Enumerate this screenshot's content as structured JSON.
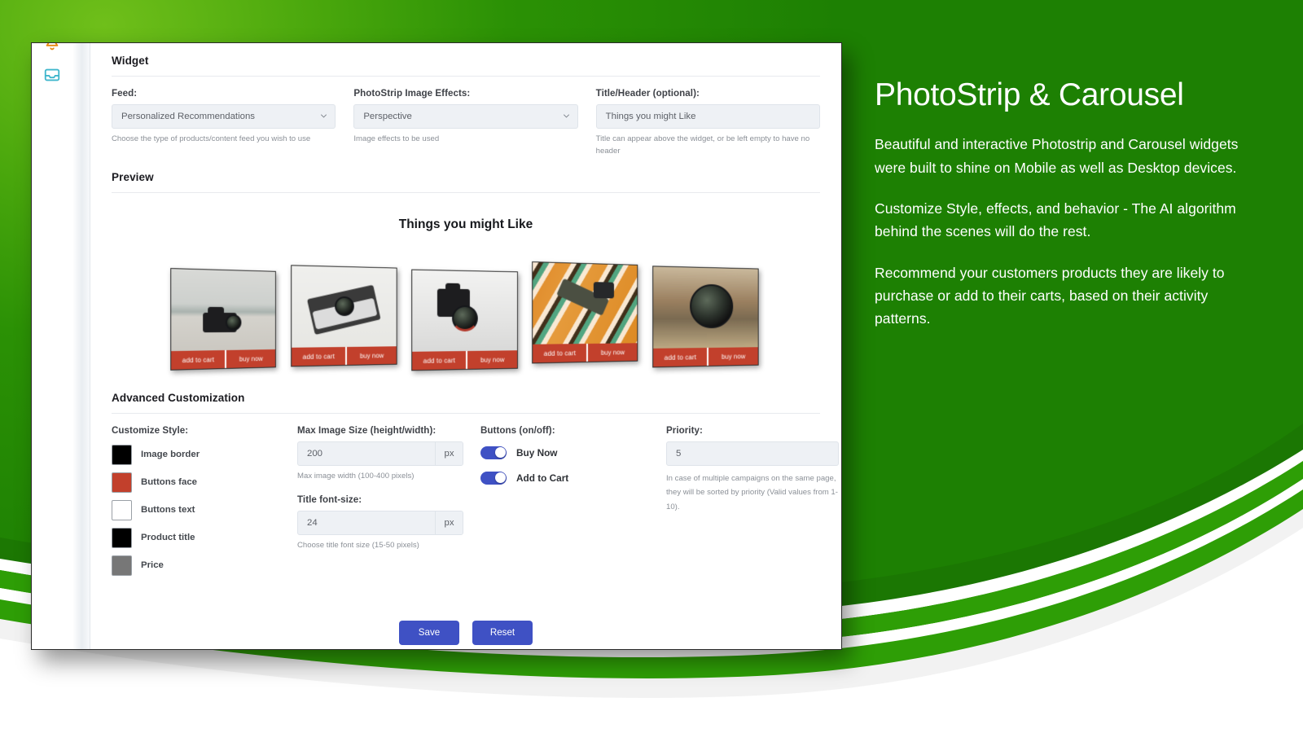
{
  "window": {
    "rail_icons": [
      {
        "name": "bell-icon",
        "color": "#e8870c"
      },
      {
        "name": "inbox-icon",
        "color": "#3fb6cc"
      }
    ]
  },
  "widget_section": {
    "title": "Widget",
    "fields": [
      {
        "label": "Feed:",
        "value": "Personalized Recommendations",
        "hint": "Choose the type of products/content feed you wish to use",
        "control": "select"
      },
      {
        "label": "PhotoStrip Image Effects:",
        "value": "Perspective",
        "hint": "Image effects to be used",
        "control": "select"
      },
      {
        "label": "Title/Header (optional):",
        "value": "Things you might Like",
        "hint": "Title can appear above the widget, or be left empty to have no header",
        "control": "text"
      }
    ]
  },
  "preview": {
    "title": "Preview",
    "widget_title": "Things you might Like",
    "cards": [
      {
        "alt": "dslr-camera-on-sand",
        "add_label": "add to cart",
        "buy_label": "buy now"
      },
      {
        "alt": "vintage-film-camera",
        "add_label": "add to cart",
        "buy_label": "buy now"
      },
      {
        "alt": "dslr-camera-white-table",
        "add_label": "add to cart",
        "buy_label": "buy now"
      },
      {
        "alt": "camera-on-striped-cloth",
        "add_label": "add to cart",
        "buy_label": "buy now"
      },
      {
        "alt": "camera-lens-closeup",
        "add_label": "add to cart",
        "buy_label": "buy now"
      }
    ]
  },
  "advanced": {
    "title": "Advanced Customization",
    "customize_style": {
      "label": "Customize Style:",
      "swatches": [
        {
          "label": "Image border",
          "color": "#000000"
        },
        {
          "label": "Buttons face",
          "color": "#c2402c"
        },
        {
          "label": "Buttons text",
          "color": "#ffffff"
        },
        {
          "label": "Product title",
          "color": "#000000"
        },
        {
          "label": "Price",
          "color": "#777777"
        }
      ]
    },
    "max_image_size": {
      "label": "Max Image Size (height/width):",
      "value": "200",
      "unit": "px",
      "hint": "Max image width (100-400 pixels)"
    },
    "title_font_size": {
      "label": "Title font-size:",
      "value": "24",
      "unit": "px",
      "hint": "Choose title font size (15-50 pixels)"
    },
    "buttons": {
      "label": "Buttons (on/off):",
      "toggles": [
        {
          "label": "Buy Now",
          "on": true
        },
        {
          "label": "Add to Cart",
          "on": true
        }
      ]
    },
    "priority": {
      "label": "Priority:",
      "value": "5",
      "hint": "In case of multiple campaigns on the same page, they will be sorted by priority (Valid values from 1-10)."
    }
  },
  "actions": {
    "save_label": "Save",
    "reset_label": "Reset"
  },
  "promo": {
    "heading": "PhotoStrip & Carousel",
    "paragraphs": [
      "Beautiful and interactive Photostrip and Carousel widgets were built to shine on Mobile as well as Desktop devices.",
      "Customize Style, effects, and behavior - The AI algorithm behind the scenes will do the rest.",
      "Recommend your customers products they are likely to purchase or add to their carts, based on their activity patterns."
    ]
  },
  "theme": {
    "green_light": "#6fbf1a",
    "green_dark": "#1d8003",
    "accent_blue": "#3f51c4",
    "button_red": "#c2402c"
  }
}
